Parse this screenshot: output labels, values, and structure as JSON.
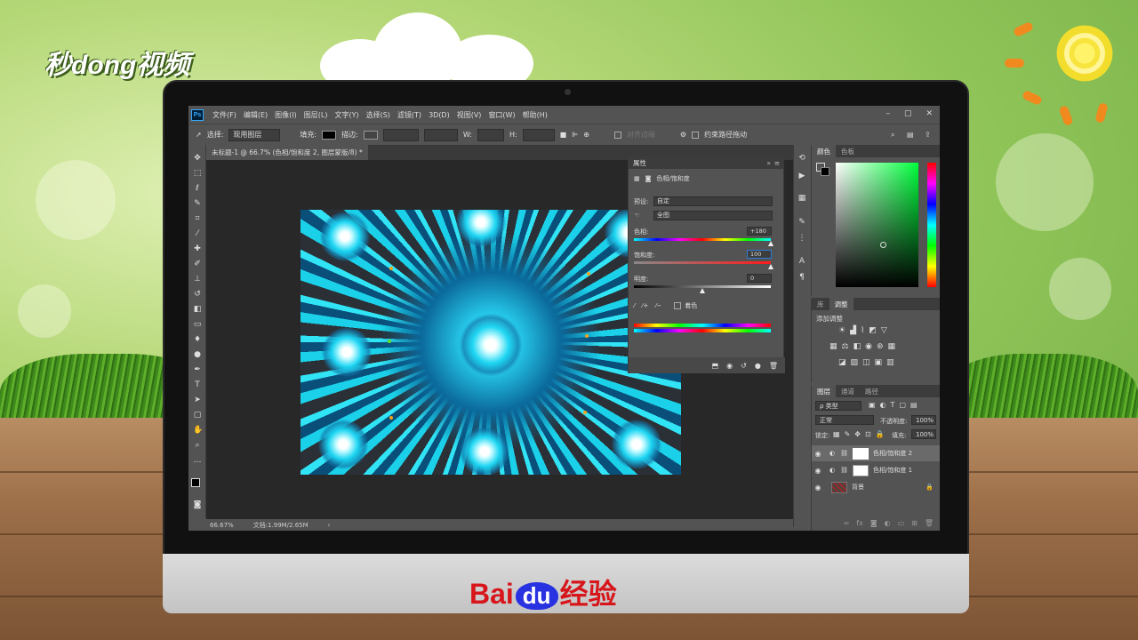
{
  "watermark": {
    "logo_text": "秒dong视频",
    "brand": "Bai",
    "brand_du": "du",
    "brand_suffix": "经验"
  },
  "app": {
    "menu": [
      "文件(F)",
      "编辑(E)",
      "图像(I)",
      "图层(L)",
      "文字(Y)",
      "选择(S)",
      "滤镜(T)",
      "3D(D)",
      "视图(V)",
      "窗口(W)",
      "帮助(H)"
    ],
    "window_buttons": [
      "–",
      "▢",
      "✕"
    ],
    "options_bar": {
      "select_label": "选择:",
      "select_value": "现用图层",
      "fill_label": "填充:",
      "stroke_label": "描边:",
      "w_label": "W:",
      "h_label": "H:",
      "align_edges": "对齐边缘",
      "constrain_path": "约束路径拖动"
    },
    "document_tab": "未标题-1 @ 66.7% (色相/饱和度 2, 图层蒙版/8) *",
    "status": {
      "zoom": "66.67%",
      "doc": "文档:1.99M/2.65M",
      "arrow": "›"
    }
  },
  "properties": {
    "title": "属性",
    "adjustment_name": "色相/饱和度",
    "preset_label": "预设:",
    "preset_value": "自定",
    "channel_value": "全图",
    "hue": {
      "label": "色相:",
      "value": "+180",
      "fraction": 1.0
    },
    "saturation": {
      "label": "饱和度:",
      "value": "100",
      "fraction": 1.0
    },
    "lightness": {
      "label": "明度:",
      "value": "0",
      "fraction": 0.5
    },
    "colorize_label": "着色"
  },
  "color_panel": {
    "tabs": [
      "颜色",
      "色板"
    ]
  },
  "adjust_panel": {
    "tabs": [
      "库",
      "调整"
    ],
    "add_label": "添加调整"
  },
  "layers_panel": {
    "tabs": [
      "图层",
      "通道",
      "路径"
    ],
    "kind_filter": "ρ 类型",
    "blend_mode": "正常",
    "opacity_label": "不透明度:",
    "opacity_value": "100%",
    "lock_label": "锁定:",
    "fill_label": "填充:",
    "fill_value": "100%",
    "layers": [
      {
        "name": "色相/饱和度 2",
        "kind": "adjustment",
        "selected": true
      },
      {
        "name": "色相/饱和度 1",
        "kind": "adjustment",
        "selected": false
      },
      {
        "name": "背景",
        "kind": "background",
        "selected": false
      }
    ],
    "bottom_icons": [
      "link-icon",
      "fx-icon",
      "mask-icon",
      "adjustment-icon",
      "folder-icon",
      "new-layer-icon",
      "trash-icon"
    ]
  },
  "colors": {
    "ps_bg": "#535353",
    "panel_dark": "#3c3c3c",
    "brand_red": "#d7161b",
    "brand_blue": "#2932e1"
  }
}
